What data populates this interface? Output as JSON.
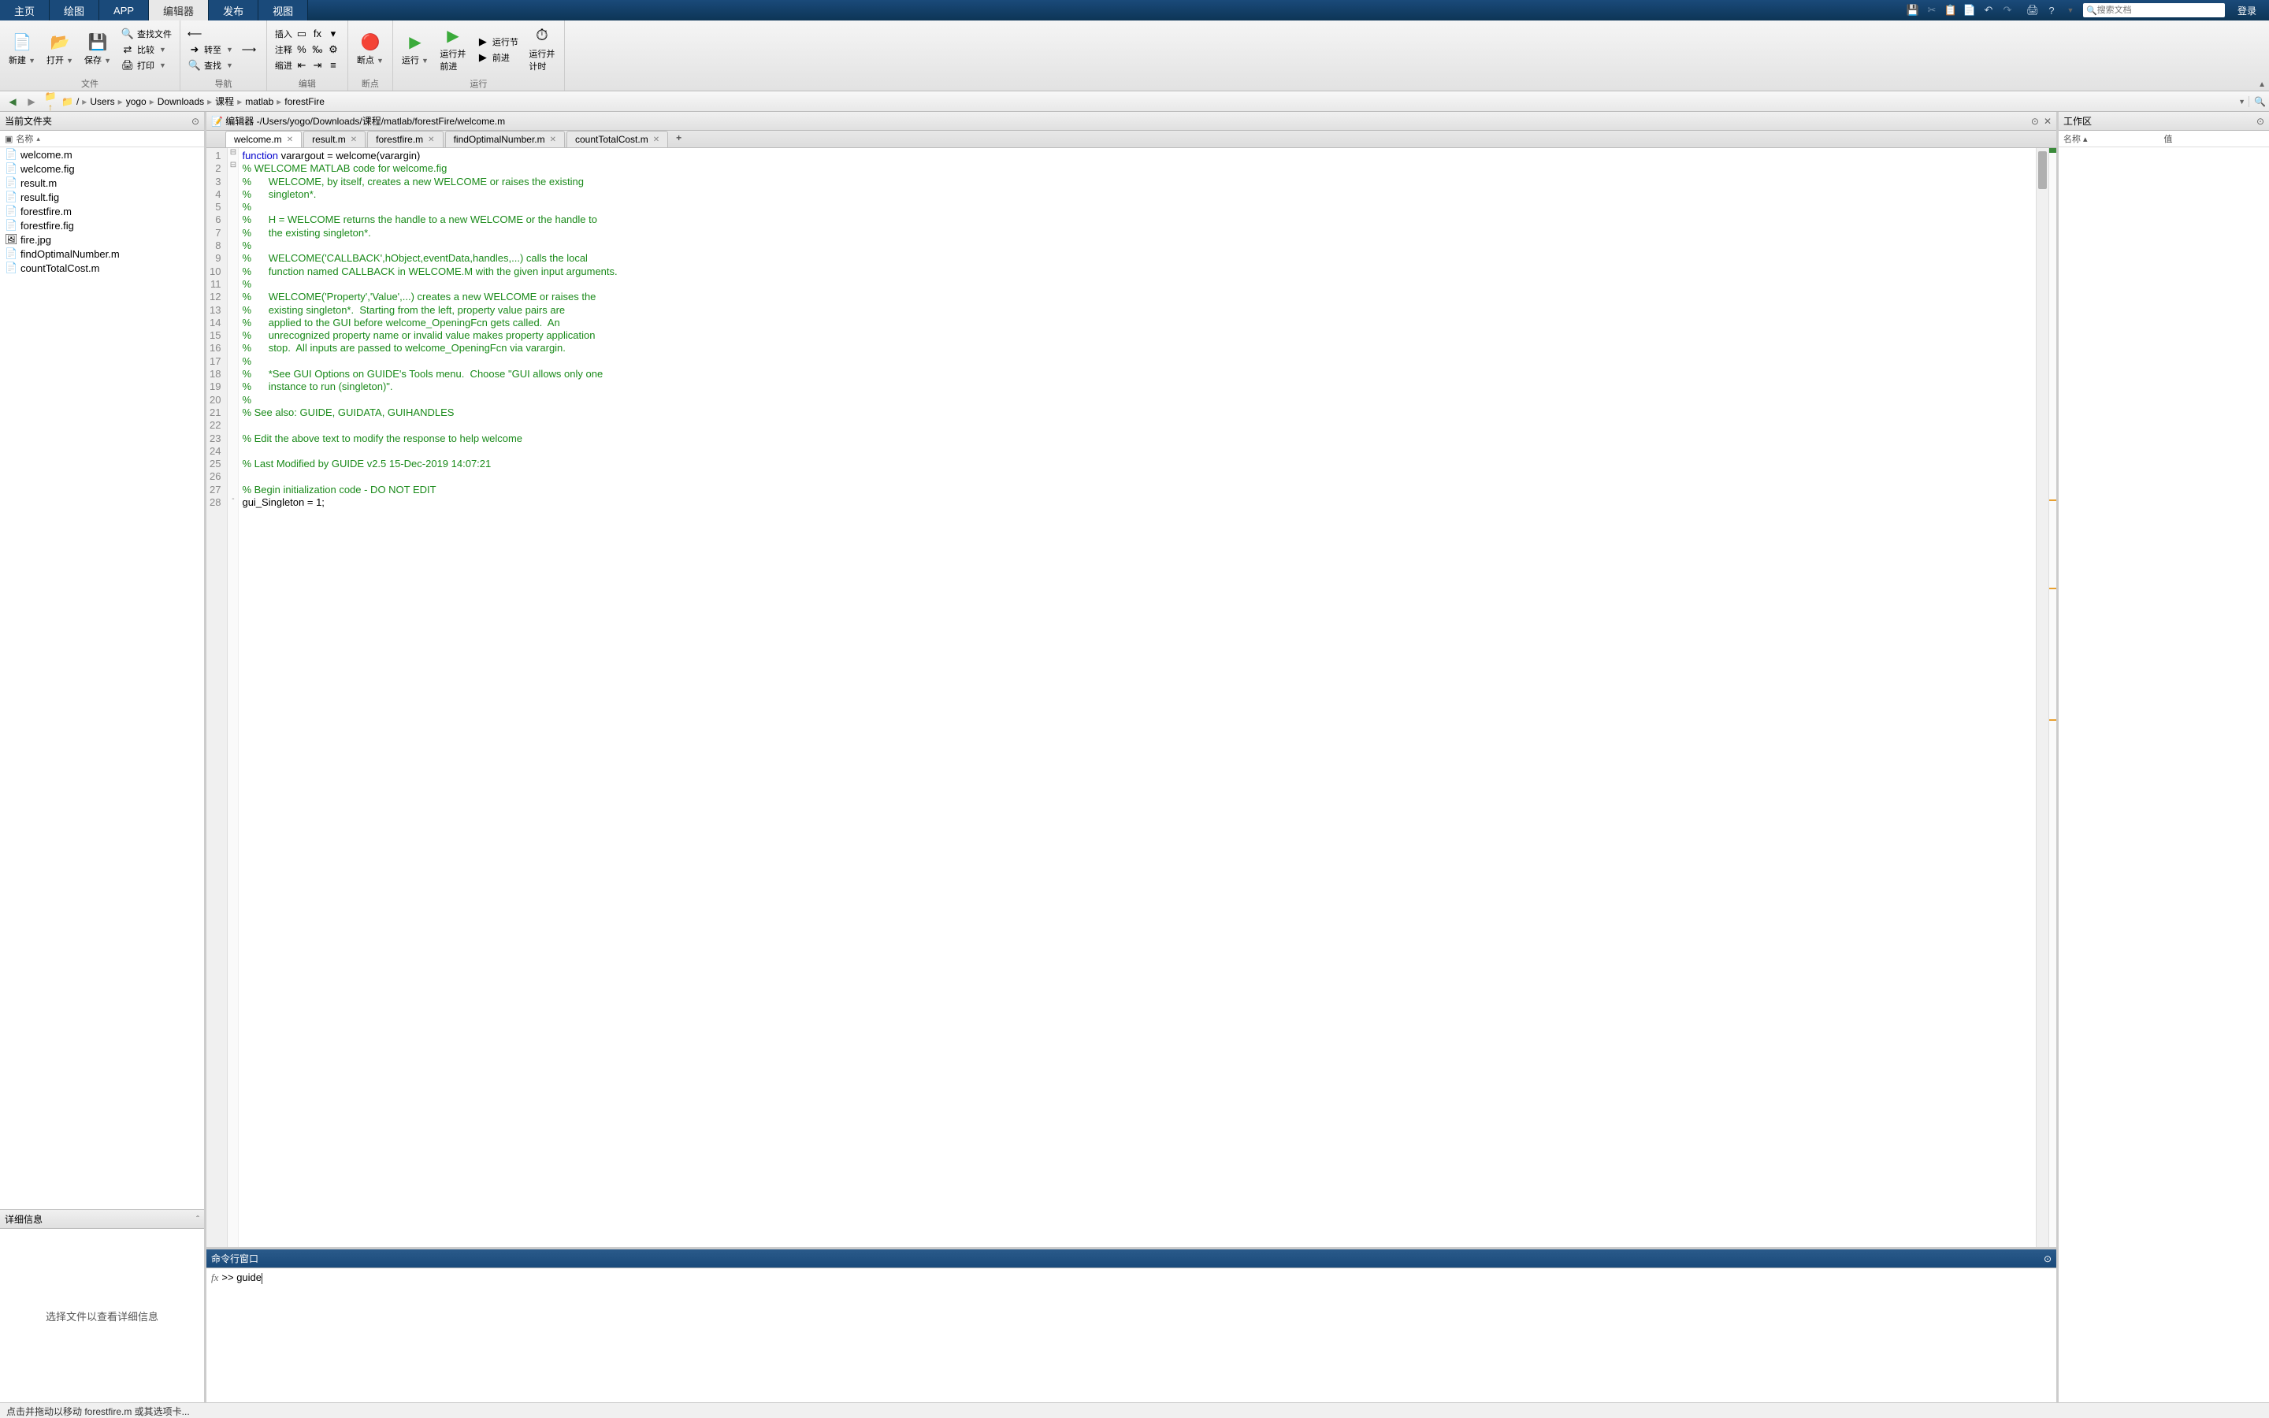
{
  "topbar": {
    "tabs": [
      "主页",
      "绘图",
      "APP",
      "编辑器",
      "发布",
      "视图"
    ],
    "active_index": 3,
    "search_placeholder": "搜索文档",
    "login": "登录"
  },
  "ribbon": {
    "groups": [
      {
        "label": "文件",
        "large": [
          {
            "icon": "📄",
            "color": "#e8c040",
            "label": "新建",
            "has_dd": true
          },
          {
            "icon": "📂",
            "color": "#d89020",
            "label": "打开",
            "has_dd": true
          },
          {
            "icon": "💾",
            "color": "#5a7aaa",
            "label": "保存",
            "has_dd": true
          }
        ],
        "cols": [
          [
            {
              "icon": "🔍",
              "label": "查找文件"
            },
            {
              "icon": "⇄",
              "label": "比较",
              "dd": true
            },
            {
              "icon": "🖨",
              "label": "打印",
              "dd": true
            }
          ]
        ]
      },
      {
        "label": "导航",
        "cols": [
          [
            {
              "icon": "⟵",
              "label": ""
            },
            {
              "icon": "➜",
              "label": "转至",
              "dd": true
            },
            {
              "icon": "🔍",
              "label": "查找",
              "dd": true
            }
          ],
          [
            {
              "icon": "⟶",
              "label": ""
            }
          ]
        ]
      },
      {
        "label": "编辑",
        "rows": [
          {
            "label": "插入",
            "icons": [
              "▭",
              "fx",
              "▾"
            ]
          },
          {
            "label": "注释",
            "icons": [
              "%",
              "‰",
              "⚙"
            ]
          },
          {
            "label": "缩进",
            "icons": [
              "⇤",
              "⇥",
              "≡"
            ]
          }
        ]
      },
      {
        "label": "断点",
        "large": [
          {
            "icon": "🔴",
            "label": "断点",
            "has_dd": true
          }
        ]
      },
      {
        "label": "运行",
        "large": [
          {
            "icon": "▶",
            "color": "#3aaa3a",
            "label": "运行",
            "has_dd": true
          },
          {
            "icon": "▶",
            "color": "#3aaa3a",
            "label": "运行并\n前进"
          }
        ],
        "cols": [
          [
            {
              "icon": "▶",
              "label": "运行节"
            },
            {
              "icon": "▶",
              "label": "前进"
            }
          ]
        ],
        "large2": [
          {
            "icon": "⏱",
            "label": "运行并\n计时"
          }
        ]
      }
    ],
    "collapse": "▲"
  },
  "nav": {
    "crumbs": [
      "/",
      "Users",
      "yogo",
      "Downloads",
      "课程",
      "matlab",
      "forestFire"
    ]
  },
  "left": {
    "title": "当前文件夹",
    "col": "名称",
    "files": [
      {
        "icon": "📄",
        "name": "welcome.m"
      },
      {
        "icon": "📄",
        "name": "welcome.fig"
      },
      {
        "icon": "📄",
        "name": "result.m"
      },
      {
        "icon": "📄",
        "name": "result.fig"
      },
      {
        "icon": "📄",
        "name": "forestfire.m"
      },
      {
        "icon": "📄",
        "name": "forestfire.fig"
      },
      {
        "icon": "🖼",
        "name": "fire.jpg"
      },
      {
        "icon": "📄",
        "name": "findOptimalNumber.m"
      },
      {
        "icon": "📄",
        "name": "countTotalCost.m"
      }
    ],
    "detail_title": "详细信息",
    "detail_body": "选择文件以查看详细信息"
  },
  "editor": {
    "title_prefix": "编辑器 - ",
    "path": "/Users/yogo/Downloads/课程/matlab/forestFire/welcome.m",
    "tabs": [
      "welcome.m",
      "result.m",
      "forestfire.m",
      "findOptimalNumber.m",
      "countTotalCost.m"
    ],
    "active_tab": 0,
    "code": [
      {
        "n": 1,
        "fold": "⊟",
        "kw": "function ",
        "rest": "varargout = welcome(varargin)"
      },
      {
        "n": 2,
        "fold": "⊟",
        "cm": "% WELCOME MATLAB code for welcome.fig"
      },
      {
        "n": 3,
        "cm": "%      WELCOME, by itself, creates a new WELCOME or raises the existing"
      },
      {
        "n": 4,
        "cm": "%      singleton*."
      },
      {
        "n": 5,
        "cm": "%"
      },
      {
        "n": 6,
        "cm": "%      H = WELCOME returns the handle to a new WELCOME or the handle to"
      },
      {
        "n": 7,
        "cm": "%      the existing singleton*."
      },
      {
        "n": 8,
        "cm": "%"
      },
      {
        "n": 9,
        "cm": "%      WELCOME('CALLBACK',hObject,eventData,handles,...) calls the local"
      },
      {
        "n": 10,
        "cm": "%      function named CALLBACK in WELCOME.M with the given input arguments."
      },
      {
        "n": 11,
        "cm": "%"
      },
      {
        "n": 12,
        "cm": "%      WELCOME('Property','Value',...) creates a new WELCOME or raises the"
      },
      {
        "n": 13,
        "cm": "%      existing singleton*.  Starting from the left, property value pairs are"
      },
      {
        "n": 14,
        "cm": "%      applied to the GUI before welcome_OpeningFcn gets called.  An"
      },
      {
        "n": 15,
        "cm": "%      unrecognized property name or invalid value makes property application"
      },
      {
        "n": 16,
        "cm": "%      stop.  All inputs are passed to welcome_OpeningFcn via varargin."
      },
      {
        "n": 17,
        "cm": "%"
      },
      {
        "n": 18,
        "cm": "%      *See GUI Options on GUIDE's Tools menu.  Choose \"GUI allows only one"
      },
      {
        "n": 19,
        "cm": "%      instance to run (singleton)\"."
      },
      {
        "n": 20,
        "cm": "%"
      },
      {
        "n": 21,
        "cm": "% See also: GUIDE, GUIDATA, GUIHANDLES"
      },
      {
        "n": 22,
        "rest": ""
      },
      {
        "n": 23,
        "cm": "% Edit the above text to modify the response to help welcome"
      },
      {
        "n": 24,
        "rest": ""
      },
      {
        "n": 25,
        "cm": "% Last Modified by GUIDE v2.5 15-Dec-2019 14:07:21"
      },
      {
        "n": 26,
        "rest": ""
      },
      {
        "n": 27,
        "cm": "% Begin initialization code - DO NOT EDIT"
      },
      {
        "n": 28,
        "fold": "-",
        "rest": "gui_Singleton = 1;"
      }
    ]
  },
  "cmd": {
    "title": "命令行窗口",
    "prompt": ">> ",
    "input": "guide"
  },
  "workspace": {
    "title": "工作区",
    "cols": [
      "名称 ▴",
      "值"
    ]
  },
  "status": "点击并拖动以移动 forestfire.m 或其选项卡..."
}
